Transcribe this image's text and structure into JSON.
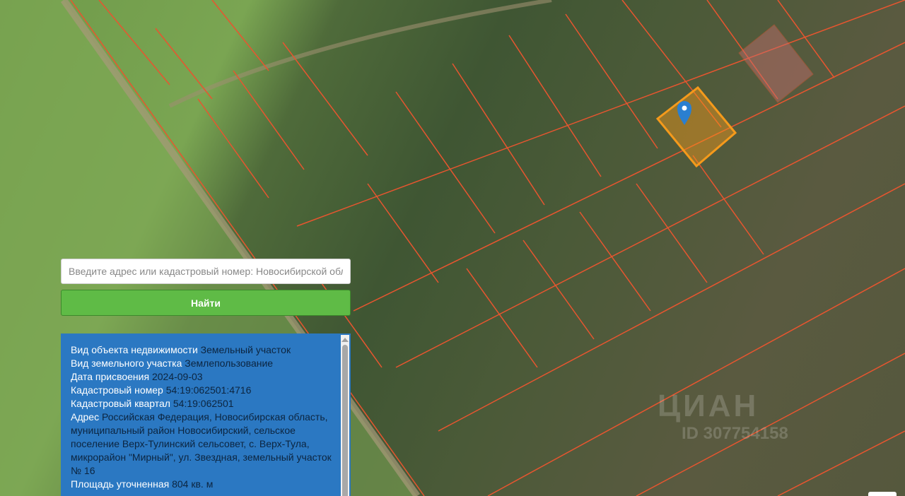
{
  "search": {
    "placeholder": "Введите адрес или кадастровый номер: Новосибирской облас",
    "value": ""
  },
  "find_button": "Найти",
  "info": [
    {
      "label": "Вид объекта недвижимости",
      "value": "Земельный участок"
    },
    {
      "label": "Вид земельного участка",
      "value": "Землепользование"
    },
    {
      "label": "Дата присвоения",
      "value": "2024-09-03"
    },
    {
      "label": "Кадастровый номер",
      "value": "54:19:062501:4716"
    },
    {
      "label": "Кадастровый квартал",
      "value": "54:19:062501"
    },
    {
      "label": "Адрес",
      "value": "Российская Федерация, Новосибирская область, муниципальный район Новосибирский, сельское поселение Верх-Тулинский сельсовет, с. Верх-Тула, микрорайон \"Мирный\", ул. Звездная, земельный участок № 16"
    },
    {
      "label": "Площадь уточненная",
      "value": "804 кв. м"
    }
  ],
  "watermark": {
    "brand": "ЦИАН",
    "id": "ID 307754158"
  },
  "colors": {
    "parcel_line": "#e8552f",
    "selected_parcel": "#f59a1b",
    "button": "#5fbb46",
    "panel": "#2b78c2",
    "marker": "#2a7fd0"
  }
}
